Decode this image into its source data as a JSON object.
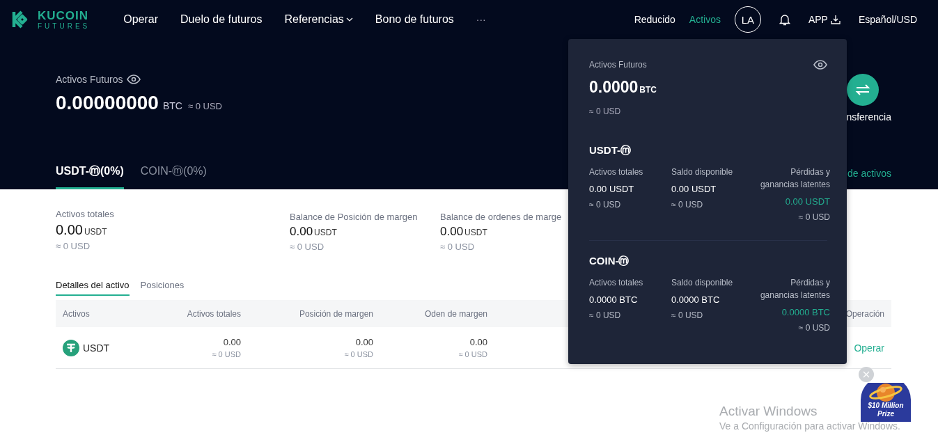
{
  "header": {
    "logo": {
      "name": "KUCOIN",
      "sub": "FUTURES"
    },
    "nav": [
      {
        "label": "Operar",
        "dropdown": false
      },
      {
        "label": "Duelo de futuros",
        "dropdown": false
      },
      {
        "label": "Referencias",
        "dropdown": true
      },
      {
        "label": "Bono de futuros",
        "dropdown": false
      }
    ],
    "more": "···",
    "right_links": [
      {
        "label": "Reducido",
        "selected": false
      },
      {
        "label": "Activos",
        "selected": true
      }
    ],
    "avatar": "LA",
    "app": "APP",
    "language": "Español/USD"
  },
  "hero": {
    "title": "Activos Futuros",
    "amount": "0.00000000",
    "unit": "BTC",
    "usd": "≈ 0 USD",
    "transfer_label": "nsferencia"
  },
  "tabs": [
    {
      "label": "USDT-ⓜ(0%)",
      "selected": true
    },
    {
      "label": "COIN-ⓜ(0%)",
      "selected": false
    }
  ],
  "tabs_link": "de activos",
  "stats": [
    {
      "title": "Activos totales",
      "value": "0.00",
      "unit": "USDT",
      "usd": "≈ 0 USD"
    },
    {
      "title": "Balance de Posición de margen",
      "value": "0.00",
      "unit": "USDT",
      "usd": "≈ 0 USD"
    },
    {
      "title": "Balance de ordenes de marge",
      "value": "0.00",
      "unit": "USDT",
      "usd": "≈ 0 USD"
    }
  ],
  "subtabs": [
    {
      "label": "Detalles del activo",
      "selected": true
    },
    {
      "label": "Posiciones",
      "selected": false
    }
  ],
  "table": {
    "columns": [
      "Activos",
      "Activos totales",
      "Posición de margen",
      "Oden de margen",
      "Operación"
    ],
    "rows": [
      {
        "cells": [
          {
            "kind": "asset",
            "value": "USDT"
          },
          {
            "kind": "amount",
            "value": "0.00",
            "usd": "≈ 0 USD"
          },
          {
            "kind": "amount",
            "value": "0.00",
            "usd": "≈ 0 USD"
          },
          {
            "kind": "amount",
            "value": "0.00",
            "usd": "≈ 0 USD"
          },
          {
            "kind": "action",
            "value": "Operar"
          }
        ]
      }
    ]
  },
  "dropdown": {
    "title": "Activos Futuros",
    "amount": "0.0000",
    "unit": "BTC",
    "usd": "≈ 0 USD",
    "sections": [
      {
        "title": "USDT-ⓜ",
        "items": [
          {
            "kind": "plain",
            "label": "Activos totales",
            "value": "0.00 USDT",
            "usd": "≈ 0 USD"
          },
          {
            "kind": "plain",
            "label": "Saldo disponible",
            "value": "0.00 USDT",
            "usd": "≈ 0 USD"
          },
          {
            "kind": "pnl",
            "label": "Pérdidas y ganancias latentes",
            "value": "0.00 USDT",
            "usd": "≈ 0 USD"
          }
        ]
      },
      {
        "title": "COIN-ⓜ",
        "items": [
          {
            "kind": "plain",
            "label": "Activos totales",
            "value": "0.0000 BTC",
            "usd": "≈ 0 USD"
          },
          {
            "kind": "plain",
            "label": "Saldo disponible",
            "value": "0.0000 BTC",
            "usd": "≈ 0 USD"
          },
          {
            "kind": "pnl",
            "label": "Pérdidas y ganancias latentes",
            "value": "0.0000 BTC",
            "usd": "≈ 0 USD"
          }
        ]
      }
    ]
  },
  "prize": {
    "line1": "$10 Million",
    "line2": "Prize"
  },
  "windows_notice": {
    "title": "Activar Windows",
    "text": "Ve a Configuración para activar Windows."
  }
}
